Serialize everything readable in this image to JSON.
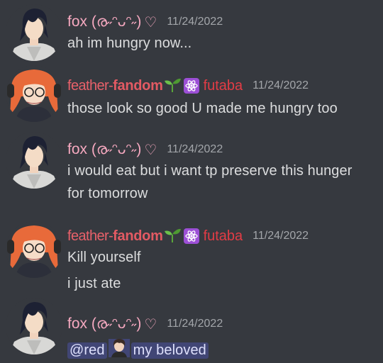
{
  "messages": [
    {
      "author": "fox (ര˶ᵔᴗᵔ˶)",
      "heart": "♡",
      "timestamp": "11/24/2022",
      "lines": [
        "ah im hungry now..."
      ]
    },
    {
      "author_part1": "feather-",
      "author_part2": "fandom",
      "tag": "futaba",
      "timestamp": "11/24/2022",
      "lines": [
        "those look so good U made me hungry too"
      ]
    },
    {
      "author": "fox (ര˶ᵔᴗᵔ˶)",
      "heart": "♡",
      "timestamp": "11/24/2022",
      "lines": [
        "i would eat but i want tp preserve this hunger",
        "for tomorrow"
      ]
    },
    {
      "author_part1": "feather-",
      "author_part2": "fandom",
      "tag": "futaba",
      "timestamp": "11/24/2022",
      "lines": [
        "Kill yourself",
        "i just ate"
      ]
    },
    {
      "author": "fox (ര˶ᵔᴗᵔ˶)",
      "heart": "♡",
      "timestamp": "11/24/2022",
      "mention": "@red",
      "mention_text": "my beloved"
    }
  ],
  "colors": {
    "background": "#36393f",
    "fox_name": "#f6a9c0",
    "feather_name": "#e35a63",
    "futaba_tag": "#e23c45",
    "timestamp": "#a3a6aa",
    "text": "#dcddde",
    "mention_bg": "#414675",
    "atom_badge": "#9c4fd6"
  },
  "icons": {
    "avatar_fox": "yusuke-avatar-icon",
    "avatar_feather": "futaba-avatar-icon",
    "sprout": "seedling-icon",
    "atom": "atom-icon",
    "heart": "heart-outline-icon"
  }
}
